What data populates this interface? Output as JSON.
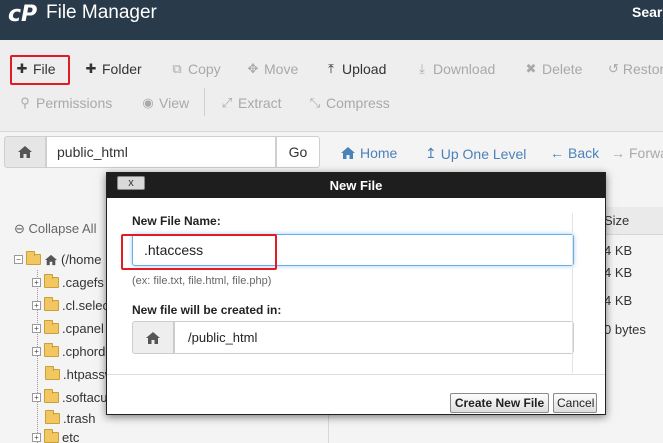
{
  "header": {
    "logo": "cP",
    "title": "File Manager",
    "search_label": "Search"
  },
  "toolbar": {
    "row1": [
      {
        "name": "file",
        "icon": "plus-icon",
        "glyph": "✚",
        "label": "File",
        "enabled": true
      },
      {
        "name": "folder",
        "icon": "plus-icon",
        "glyph": "✚",
        "label": "Folder",
        "enabled": true
      },
      {
        "name": "copy",
        "icon": "copy-icon",
        "glyph": "⧉",
        "label": "Copy",
        "enabled": false
      },
      {
        "name": "move",
        "icon": "move-icon",
        "glyph": "✥",
        "label": "Move",
        "enabled": false
      },
      {
        "name": "upload",
        "icon": "upload-icon",
        "glyph": "⤒",
        "label": "Upload",
        "enabled": true
      },
      {
        "name": "download",
        "icon": "download-icon",
        "glyph": "⤓",
        "label": "Download",
        "enabled": false
      },
      {
        "name": "delete",
        "icon": "delete-icon",
        "glyph": "✖",
        "label": "Delete",
        "enabled": false
      },
      {
        "name": "restore",
        "icon": "restore-icon",
        "glyph": "↺",
        "label": "Restore",
        "enabled": false
      }
    ],
    "row2": [
      {
        "name": "permissions",
        "icon": "key-icon",
        "glyph": "⚲",
        "label": "Permissions",
        "enabled": false
      },
      {
        "name": "view",
        "icon": "eye-icon",
        "glyph": "◉",
        "label": "View",
        "enabled": false
      },
      {
        "name": "extract",
        "icon": "extract-icon",
        "glyph": "⤢",
        "label": "Extract",
        "enabled": false
      },
      {
        "name": "compress",
        "icon": "compress-icon",
        "glyph": "⤡",
        "label": "Compress",
        "enabled": false
      }
    ]
  },
  "pathbar": {
    "path_value": "public_html",
    "go_label": "Go",
    "links": [
      {
        "name": "home",
        "icon": "home-icon",
        "glyph": "⌂",
        "label": "Home",
        "enabled": true
      },
      {
        "name": "up-one-level",
        "icon": "up-arrow-icon",
        "glyph": "↥",
        "label": "Up One Level",
        "enabled": true
      },
      {
        "name": "back",
        "icon": "back-arrow-icon",
        "glyph": "←",
        "label": "Back",
        "enabled": true
      },
      {
        "name": "forward",
        "icon": "forward-arrow-icon",
        "glyph": "→",
        "label": "Forward",
        "enabled": false
      }
    ]
  },
  "tree": {
    "collapse_label": "Collapse All",
    "root": "(/home",
    "items": [
      ".cagefs",
      ".cl.selector",
      ".cpanel",
      ".cphorde",
      ".htpasswds",
      ".softaculous",
      ".trash",
      "etc"
    ]
  },
  "file_list": {
    "size_header": "Size",
    "sizes": [
      "4 KB",
      "4 KB",
      "4 KB",
      "0 bytes"
    ]
  },
  "dialog": {
    "title": "New File",
    "close_label": "x",
    "name_label": "New File Name:",
    "name_value": ".htaccess",
    "hint": "(ex: file.txt, file.html, file.php)",
    "location_label": "New file will be created in:",
    "location_value": "/public_html",
    "create_label": "Create New File",
    "cancel_label": "Cancel"
  },
  "colors": {
    "header_bg": "#293a4a",
    "link_blue": "#4a82b9",
    "highlight_red": "#e31b23",
    "focus_blue": "#66afe9"
  }
}
